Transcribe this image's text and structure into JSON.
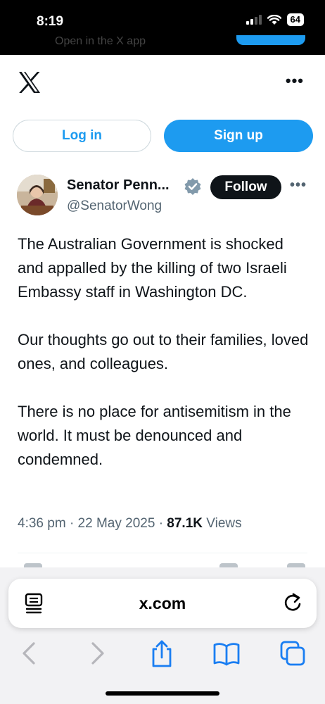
{
  "status_bar": {
    "time": "8:19",
    "battery": "64"
  },
  "behind_banner": {
    "text": "Open in the X app"
  },
  "header": {
    "logo_icon": "x-logo-icon",
    "more_icon": "more-icon"
  },
  "auth": {
    "login_label": "Log in",
    "signup_label": "Sign up"
  },
  "tweet": {
    "author_name": "Senator Penn...",
    "handle": "@SenatorWong",
    "follow_label": "Follow",
    "paragraphs": [
      "The Australian Government is shocked and appalled by the killing of two Israeli Embassy staff in Washington DC.",
      "Our thoughts go out to their families, loved ones, and colleagues.",
      "There is no place for antisemitism in the world. It must be denounced and condemned."
    ],
    "time": "4:36 pm",
    "date": "22 May 2025",
    "views_count": "87.1K",
    "views_label": "Views"
  },
  "browser": {
    "url": "x.com"
  },
  "colors": {
    "accent": "#1d9bf0",
    "text": "#0f1419",
    "muted": "#536471"
  }
}
